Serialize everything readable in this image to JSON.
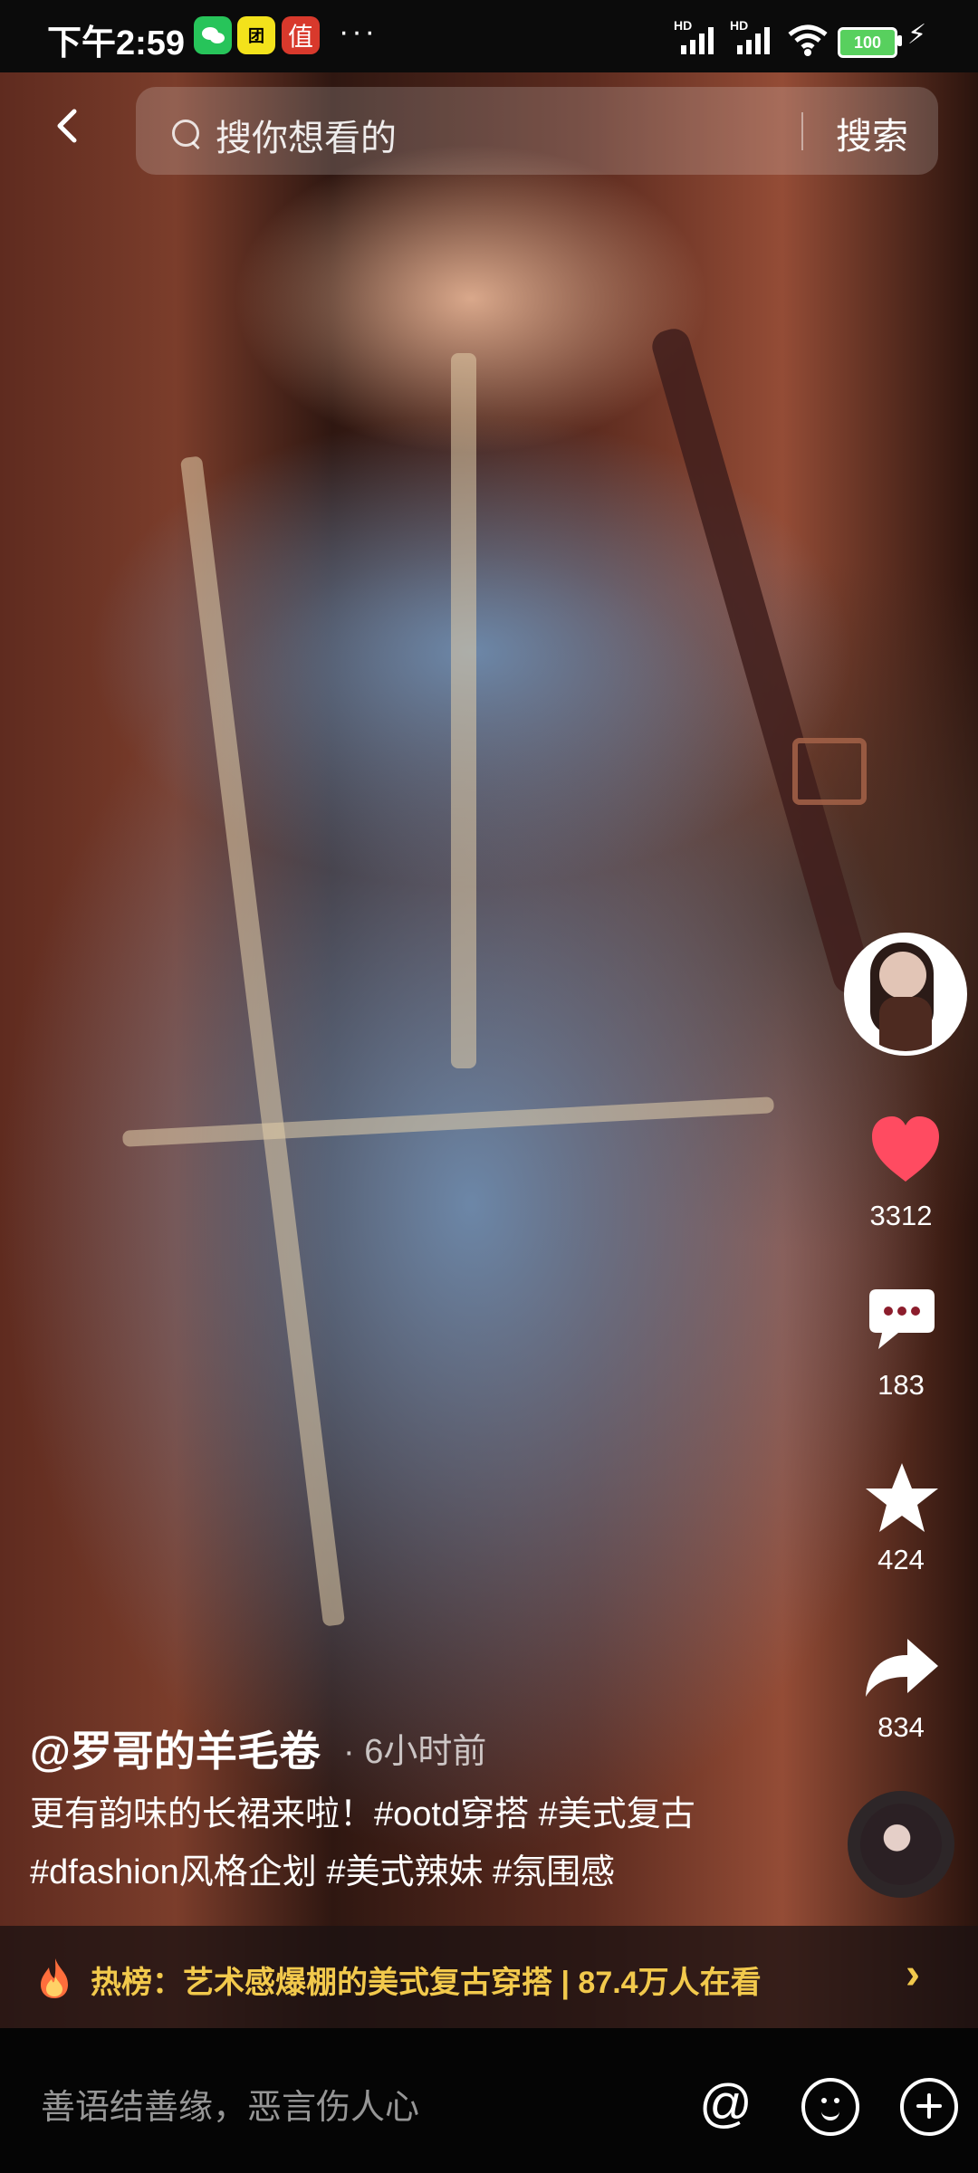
{
  "status": {
    "time": "下午2:59",
    "apps": [
      "wechat-icon",
      "app-yellow-icon",
      "app-red-icon"
    ],
    "app_badge_text": "值",
    "more": "···",
    "hd_left": "HD",
    "hd_right": "HD",
    "battery": "100"
  },
  "header": {
    "search_placeholder": "搜你想看的",
    "search_button": "搜索"
  },
  "actions": {
    "likes": "3312",
    "comments": "183",
    "favorites": "424",
    "shares": "834"
  },
  "caption": {
    "author": "@罗哥的羊毛卷",
    "time": "· 6小时前",
    "text": "更有韵味的长裙来啦！#ootd穿搭 #美式复古 #dfashion风格企划 #美式辣妹 #氛围感"
  },
  "hot": {
    "label": "热榜：艺术感爆棚的美式复古穿搭 | 87.4万人在看"
  },
  "comment": {
    "placeholder": "善语结善缘，恶言伤人心"
  },
  "colors": {
    "like": "#ff4b61",
    "hot": "#f2c94c",
    "battery": "#58d05e"
  }
}
